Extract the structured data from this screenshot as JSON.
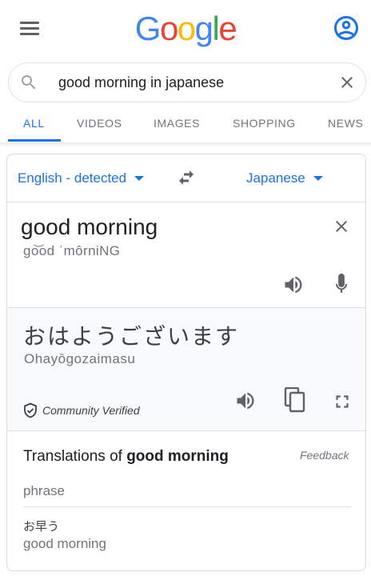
{
  "header": {
    "logo_letters": [
      "G",
      "o",
      "o",
      "g",
      "l",
      "e"
    ],
    "menu_icon": "hamburger-menu-icon",
    "account_icon": "account-circle-icon"
  },
  "search": {
    "query": "good morning in japanese",
    "placeholder": "",
    "search_icon": "search-icon",
    "clear_icon": "close-icon"
  },
  "tabs": [
    {
      "label": "ALL",
      "active": true
    },
    {
      "label": "VIDEOS",
      "active": false
    },
    {
      "label": "IMAGES",
      "active": false
    },
    {
      "label": "SHOPPING",
      "active": false
    },
    {
      "label": "NEWS",
      "active": false
    }
  ],
  "translate": {
    "source_language": "English - detected",
    "target_language": "Japanese",
    "source_text": "good morning",
    "source_transliteration": "go͝od ˈmôrniNG",
    "target_text": "おはようございます",
    "target_transliteration": "Ohayōgozaimasu",
    "verified_label": "Community Verified"
  },
  "translations": {
    "heading_prefix": "Translations of ",
    "heading_term": "good morning",
    "feedback_label": "Feedback",
    "part_of_speech": "phrase",
    "entries": [
      {
        "word": "お早う",
        "meaning": "good morning"
      }
    ]
  },
  "colors": {
    "accent": "#1a73e8",
    "logo_blue": "#4285F4",
    "logo_red": "#EA4335",
    "logo_yellow": "#FBBC05",
    "logo_green": "#34A853",
    "icon_gray": "#5f6368"
  }
}
